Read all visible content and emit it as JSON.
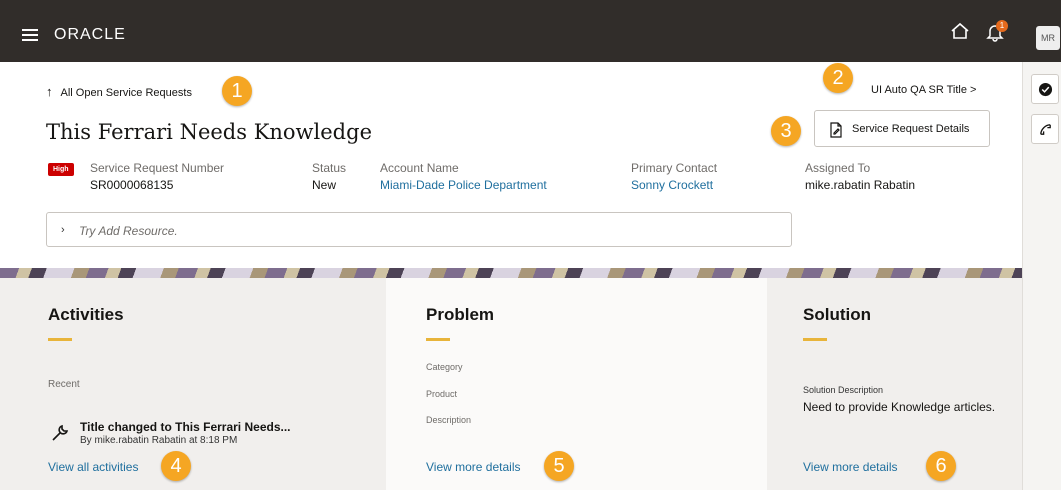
{
  "header": {
    "logo": "ORACLE",
    "notification_count": "1",
    "avatar_initials": "MR"
  },
  "page": {
    "back_label": "All Open Service Requests",
    "crumb_right": "UI Auto QA SR Title >",
    "title": "This Ferrari Needs Knowledge",
    "details_button": "Service Request Details"
  },
  "summary": {
    "priority": "High",
    "sr_number_label": "Service Request Number",
    "sr_number": "SR0000068135",
    "status_label": "Status",
    "status": "New",
    "account_label": "Account Name",
    "account": "Miami-Dade Police Department",
    "contact_label": "Primary Contact",
    "contact": "Sonny Crockett",
    "assigned_label": "Assigned To",
    "assigned": "mike.rabatin Rabatin"
  },
  "resource_input": {
    "placeholder": "Try Add Resource."
  },
  "activities": {
    "title": "Activities",
    "recent_label": "Recent",
    "item_title": "Title changed to This Ferrari Needs...",
    "item_sub": "By mike.rabatin Rabatin at 8:18 PM",
    "view_all": "View all activities"
  },
  "problem": {
    "title": "Problem",
    "category_label": "Category",
    "product_label": "Product",
    "description_label": "Description",
    "view_more": "View more details"
  },
  "solution": {
    "title": "Solution",
    "desc_label": "Solution Description",
    "desc": "Need to provide Knowledge articles.",
    "view_more": "View more details"
  },
  "callouts": [
    "1",
    "2",
    "3",
    "4",
    "5",
    "6"
  ],
  "colors": {
    "topbar": "#312d2a",
    "link": "#1f6f9e",
    "accent": "#e8b43a",
    "callout": "#f5a623",
    "high_badge": "#cc0000"
  },
  "icons": [
    "hamburger-icon",
    "home-icon",
    "bell-icon",
    "check-circle-icon",
    "phone-icon",
    "document-edit-icon",
    "wrench-icon",
    "chevron-right-icon",
    "up-arrow-icon"
  ]
}
